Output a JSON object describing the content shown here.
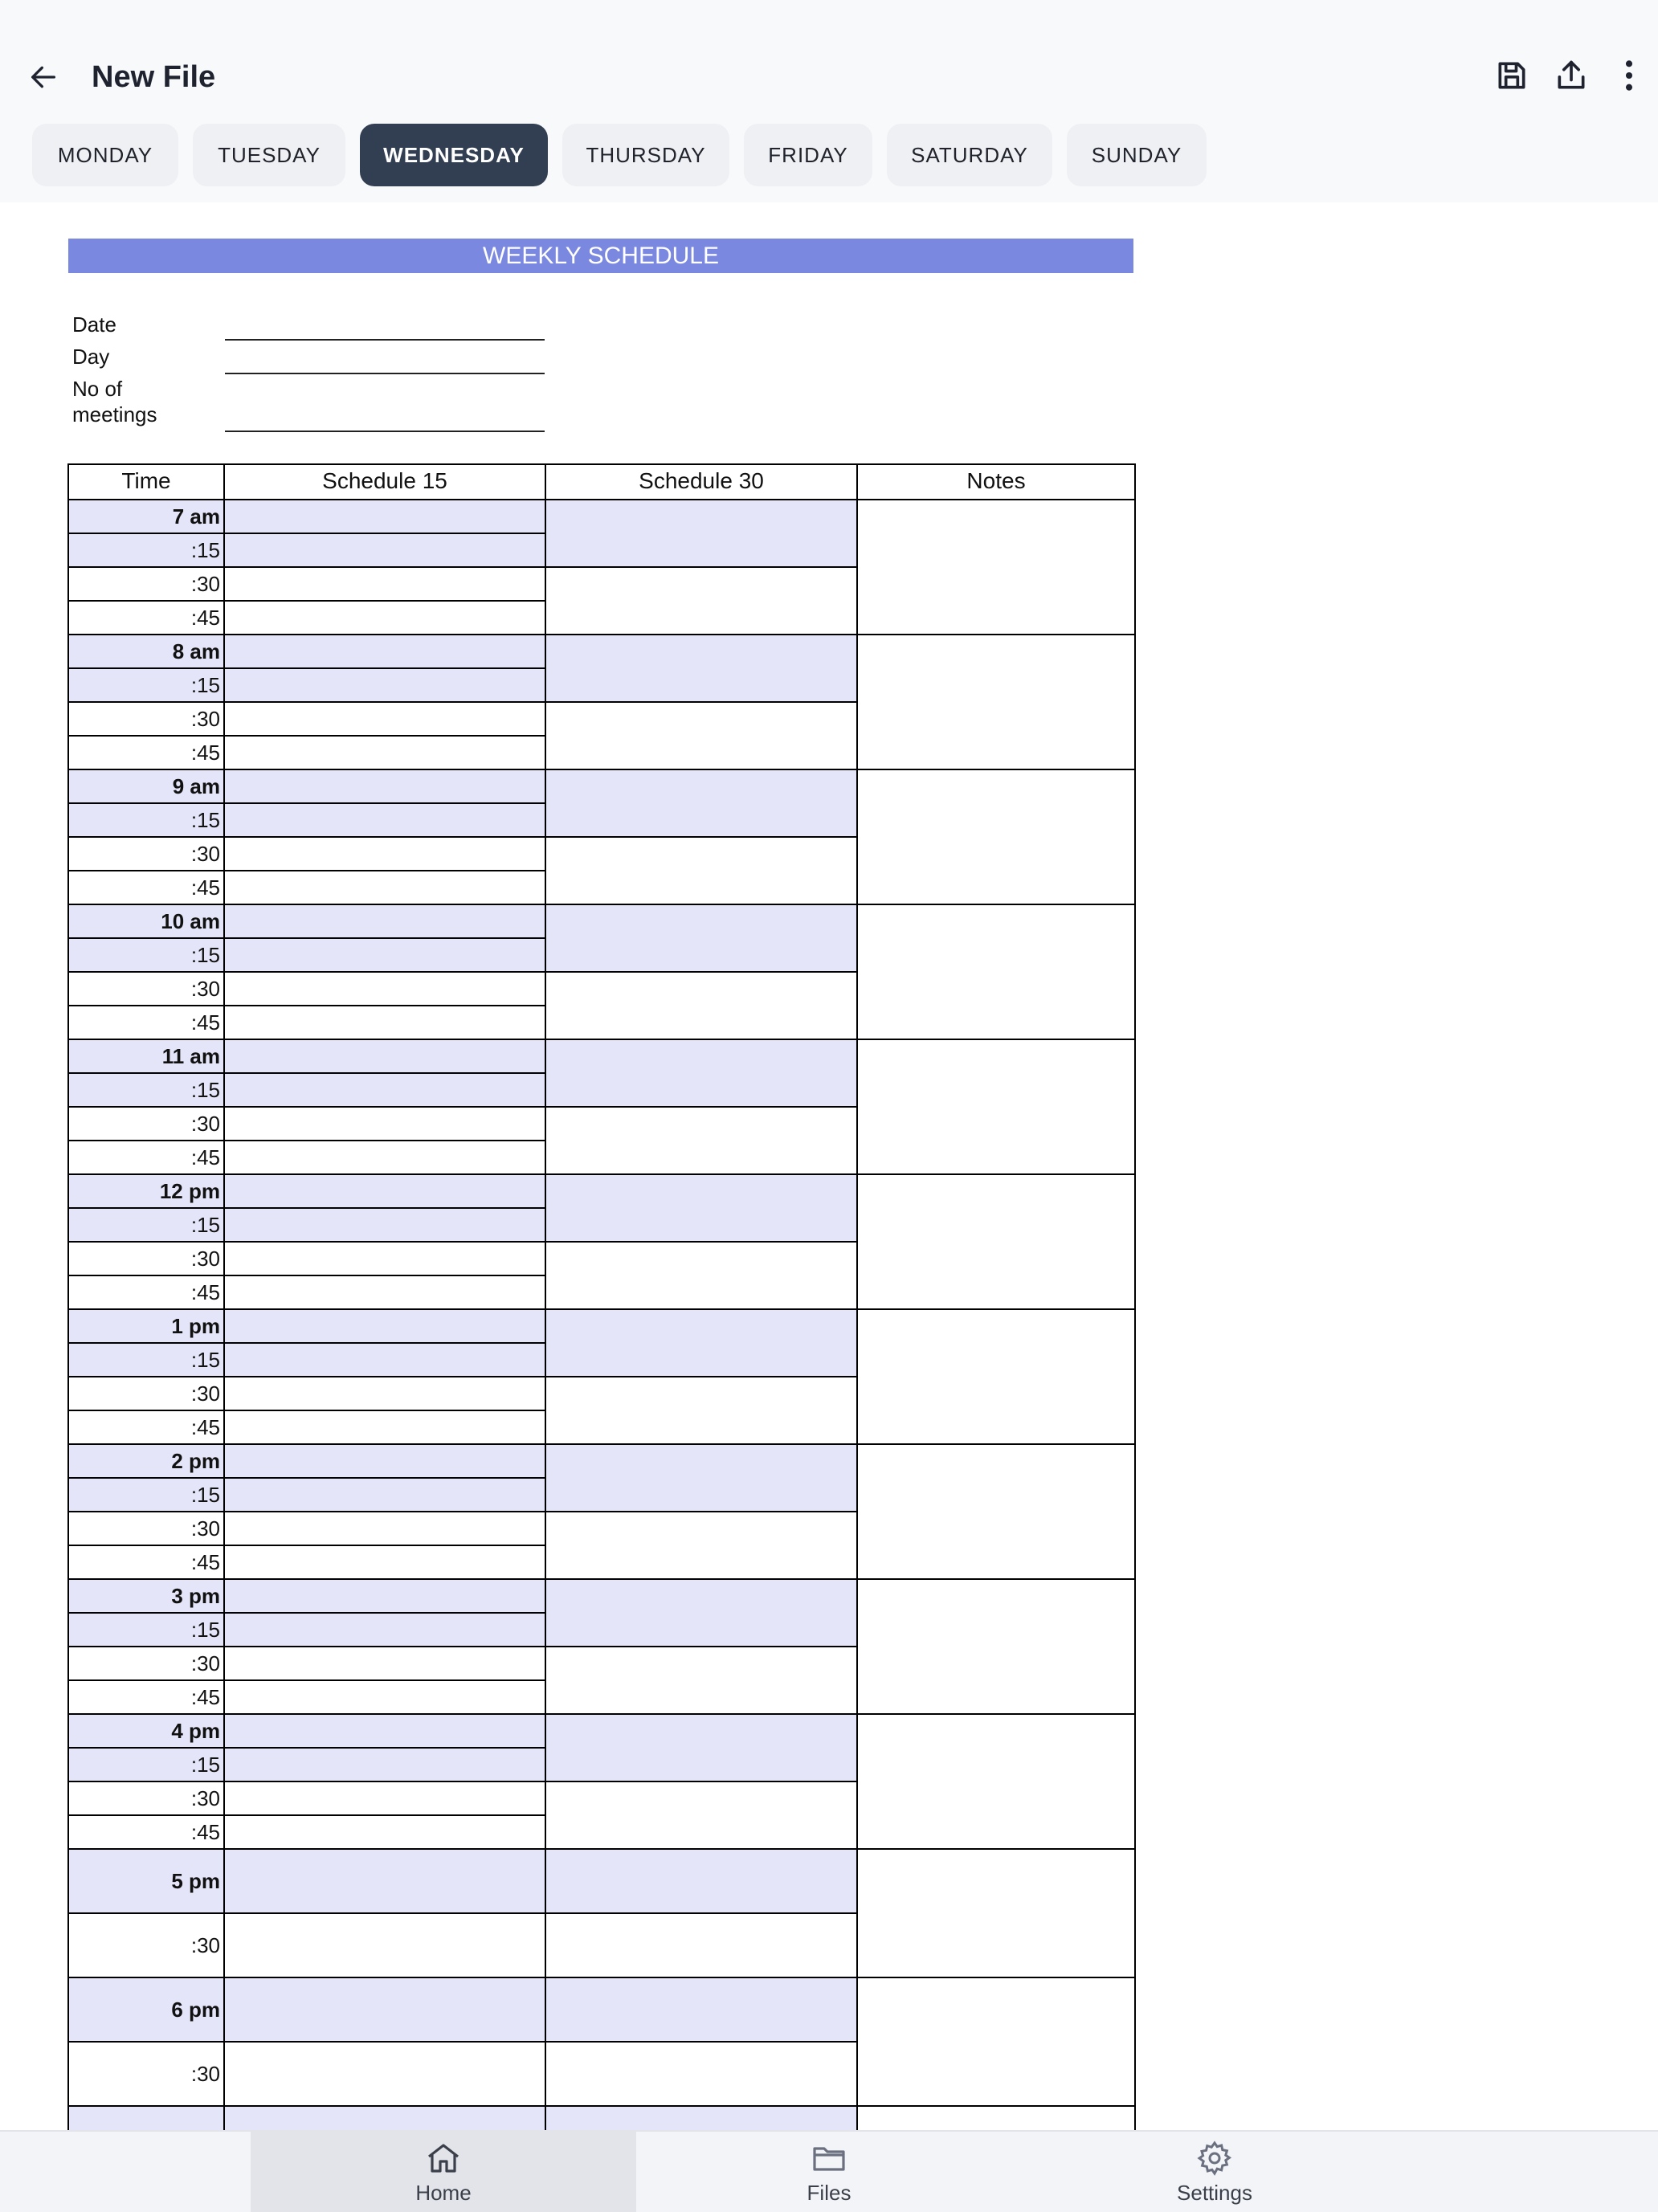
{
  "app": {
    "title": "New File"
  },
  "toolbar": {
    "back_icon": "arrow-left-icon",
    "save_icon": "save-icon",
    "share_icon": "share-icon",
    "more_icon": "more-vertical-icon"
  },
  "tabs": [
    {
      "label": "MONDAY",
      "active": false
    },
    {
      "label": "TUESDAY",
      "active": false
    },
    {
      "label": "WEDNESDAY",
      "active": true
    },
    {
      "label": "THURSDAY",
      "active": false
    },
    {
      "label": "FRIDAY",
      "active": false
    },
    {
      "label": "SATURDAY",
      "active": false
    },
    {
      "label": "SUNDAY",
      "active": false
    }
  ],
  "document": {
    "banner": "WEEKLY SCHEDULE",
    "meta": {
      "date": "Date",
      "day": "Day",
      "meetings_1": "No of",
      "meetings_2": "meetings"
    },
    "headers": {
      "time": "Time",
      "schedule15": "Schedule 15",
      "schedule30": "Schedule 30",
      "notes": "Notes"
    },
    "hours": [
      "7 am",
      "8 am",
      "9 am",
      "10 am",
      "11 am",
      "12 pm",
      "1 pm",
      "2 pm",
      "3 pm",
      "4 pm"
    ],
    "quarters": [
      ":15",
      ":30",
      ":45"
    ],
    "half_hours": [
      "5 pm",
      "6 pm"
    ],
    "half_label": ":30",
    "colors": {
      "banner": "#7b88df",
      "shade": "#e4e5f9",
      "active_tab": "#323f52"
    }
  },
  "bottom_nav": [
    {
      "label": "Home",
      "icon": "home-icon",
      "active": true
    },
    {
      "label": "Files",
      "icon": "folder-icon",
      "active": false
    },
    {
      "label": "Settings",
      "icon": "gear-icon",
      "active": false
    }
  ]
}
